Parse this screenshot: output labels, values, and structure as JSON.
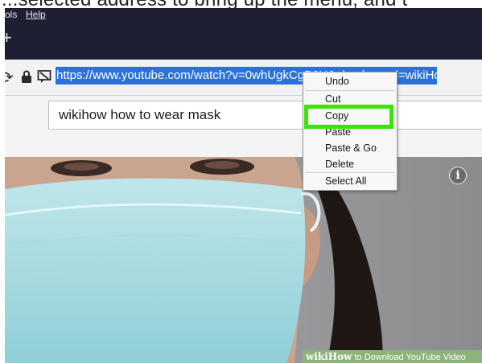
{
  "caption": {
    "text": "...selected address to bring up the menu, and t"
  },
  "menubar": {
    "items": [
      {
        "label": "ols"
      },
      {
        "label": "Help"
      }
    ]
  },
  "tabstrip": {
    "new_tab_glyph": "+"
  },
  "navbar": {
    "url": "https://www.youtube.com/watch?v=0whUgkCgP0U&ab_channel=wikiHow"
  },
  "page": {
    "search_value": "wikihow how to wear mask",
    "info_glyph": "i",
    "watermark_brand": "wiki",
    "watermark_how": "How",
    "watermark_text": "to Download YouTube Video"
  },
  "context_menu": {
    "items": [
      {
        "label": "Undo"
      },
      {
        "label": "Cut"
      },
      {
        "label": "Copy"
      },
      {
        "label": "Paste"
      },
      {
        "label": "Paste & Go"
      },
      {
        "label": "Delete"
      },
      {
        "label": "Select All"
      }
    ]
  },
  "colors": {
    "highlight": "#39e600",
    "url_selection": "#2a72d9",
    "chrome_dark": "#1f1f33"
  }
}
